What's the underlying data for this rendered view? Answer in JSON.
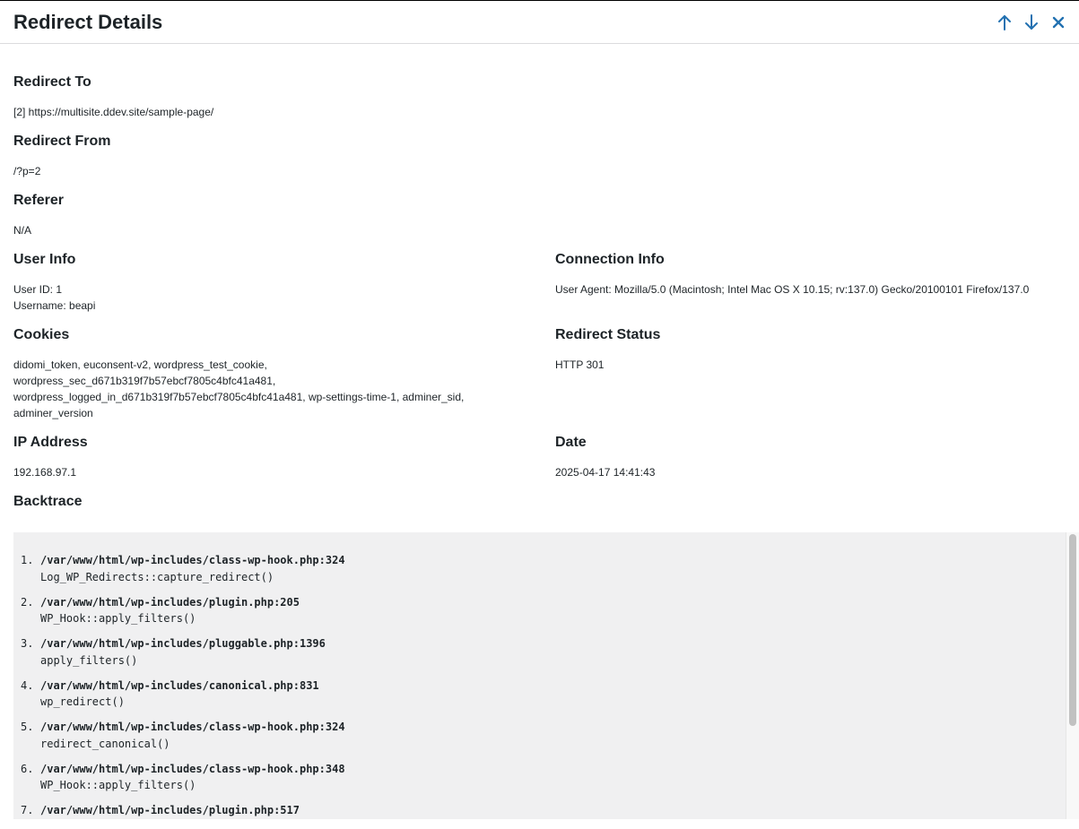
{
  "header": {
    "title": "Redirect Details",
    "actions": [
      "arrow-up-icon",
      "arrow-down-icon",
      "close-icon"
    ]
  },
  "redirect_to": {
    "heading": "Redirect To",
    "value": "[2] https://multisite.ddev.site/sample-page/"
  },
  "redirect_from": {
    "heading": "Redirect From",
    "value": "/?p=2"
  },
  "referer": {
    "heading": "Referer",
    "value": "N/A"
  },
  "user_info": {
    "heading": "User Info",
    "user_id": "User ID: 1",
    "username": "Username: beapi"
  },
  "connection_info": {
    "heading": "Connection Info",
    "value": "User Agent: Mozilla/5.0 (Macintosh; Intel Mac OS X 10.15; rv:137.0) Gecko/20100101 Firefox/137.0"
  },
  "cookies": {
    "heading": "Cookies",
    "line1": "didomi_token, euconsent-v2, wordpress_test_cookie,",
    "line2": "wordpress_sec_d671b319f7b57ebcf7805c4bfc41a481,",
    "line3": "wordpress_logged_in_d671b319f7b57ebcf7805c4bfc41a481, wp-settings-time-1, adminer_sid,",
    "line4": "adminer_version"
  },
  "redirect_status": {
    "heading": "Redirect Status",
    "value": "HTTP 301"
  },
  "ip_address": {
    "heading": "IP Address",
    "value": "192.168.97.1"
  },
  "date": {
    "heading": "Date",
    "value": "2025-04-17 14:41:43"
  },
  "backtrace": {
    "heading": "Backtrace",
    "items": [
      {
        "num": "1.",
        "file": "/var/www/html/wp-includes/class-wp-hook.php:324",
        "func": "Log_WP_Redirects::capture_redirect()"
      },
      {
        "num": "2.",
        "file": "/var/www/html/wp-includes/plugin.php:205",
        "func": "WP_Hook::apply_filters()"
      },
      {
        "num": "3.",
        "file": "/var/www/html/wp-includes/pluggable.php:1396",
        "func": "apply_filters()"
      },
      {
        "num": "4.",
        "file": "/var/www/html/wp-includes/canonical.php:831",
        "func": "wp_redirect()"
      },
      {
        "num": "5.",
        "file": "/var/www/html/wp-includes/class-wp-hook.php:324",
        "func": "redirect_canonical()"
      },
      {
        "num": "6.",
        "file": "/var/www/html/wp-includes/class-wp-hook.php:348",
        "func": "WP_Hook::apply_filters()"
      },
      {
        "num": "7.",
        "file": "/var/www/html/wp-includes/plugin.php:517",
        "func": ""
      }
    ]
  },
  "colors": {
    "accent": "#2271b1",
    "text": "#1d2327",
    "code_bg": "#f0f0f1"
  }
}
